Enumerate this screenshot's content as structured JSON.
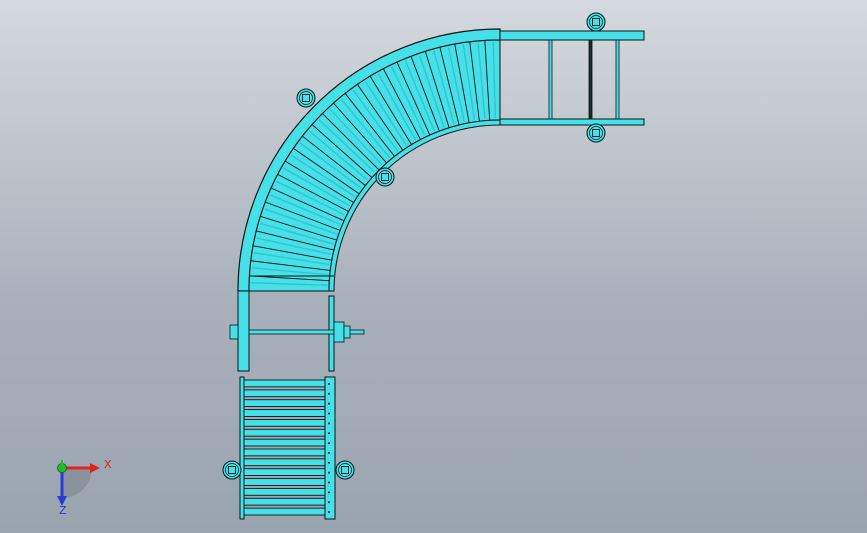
{
  "colors": {
    "part_fill": "#46e0e8",
    "part_edge": "#0c1416",
    "part_shade": "#2fb8c0",
    "axis_x": "#e0241a",
    "axis_y": "#1ebd2a",
    "axis_z": "#2a3ad8"
  },
  "triad": {
    "x_label": "X",
    "z_label": "Z"
  }
}
